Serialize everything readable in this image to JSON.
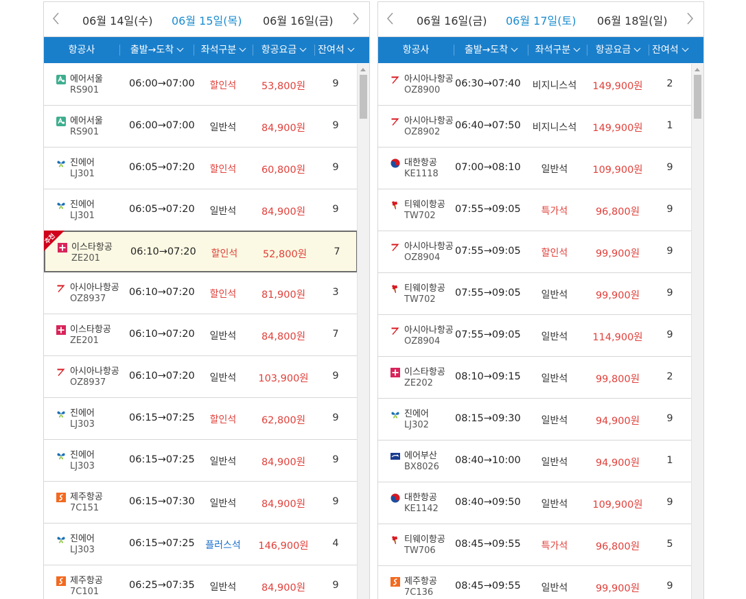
{
  "columns": {
    "airline": "항공사",
    "time": "출발→도착",
    "seat": "좌석구분",
    "fare": "항공요금",
    "remaining": "잔여석"
  },
  "badge_text": "추천",
  "colors": {
    "accent": "#1a7fcb",
    "fare": "#e0403a",
    "active_date": "#1a8ccf",
    "highlight_bg": "#fbf9e3"
  },
  "left": {
    "dates": [
      "06월 14일(수)",
      "06월 15일(목)",
      "06월 16일(금)"
    ],
    "active_index": 1,
    "rows": [
      {
        "logo": "air-seoul",
        "name": "에어서울",
        "flight": "RS901",
        "time": "06:00→07:00",
        "seat": "할인석",
        "seat_style": "red",
        "fare": "53,800원",
        "remain": "9"
      },
      {
        "logo": "air-seoul",
        "name": "에어서울",
        "flight": "RS901",
        "time": "06:00→07:00",
        "seat": "일반석",
        "seat_style": "normal",
        "fare": "84,900원",
        "remain": "9"
      },
      {
        "logo": "jin-air",
        "name": "진에어",
        "flight": "LJ301",
        "time": "06:05→07:20",
        "seat": "할인석",
        "seat_style": "red",
        "fare": "60,800원",
        "remain": "9"
      },
      {
        "logo": "jin-air",
        "name": "진에어",
        "flight": "LJ301",
        "time": "06:05→07:20",
        "seat": "일반석",
        "seat_style": "normal",
        "fare": "84,900원",
        "remain": "9"
      },
      {
        "logo": "eastar",
        "name": "이스타항공",
        "flight": "ZE201",
        "time": "06:10→07:20",
        "seat": "할인석",
        "seat_style": "red",
        "fare": "52,800원",
        "remain": "7",
        "highlight": true
      },
      {
        "logo": "asiana",
        "name": "아시아나항공",
        "flight": "OZ8937",
        "time": "06:10→07:20",
        "seat": "할인석",
        "seat_style": "red",
        "fare": "81,900원",
        "remain": "3"
      },
      {
        "logo": "eastar",
        "name": "이스타항공",
        "flight": "ZE201",
        "time": "06:10→07:20",
        "seat": "일반석",
        "seat_style": "normal",
        "fare": "84,800원",
        "remain": "7"
      },
      {
        "logo": "asiana",
        "name": "아시아나항공",
        "flight": "OZ8937",
        "time": "06:10→07:20",
        "seat": "일반석",
        "seat_style": "normal",
        "fare": "103,900원",
        "remain": "9"
      },
      {
        "logo": "jin-air",
        "name": "진에어",
        "flight": "LJ303",
        "time": "06:15→07:25",
        "seat": "할인석",
        "seat_style": "red",
        "fare": "62,800원",
        "remain": "9"
      },
      {
        "logo": "jin-air",
        "name": "진에어",
        "flight": "LJ303",
        "time": "06:15→07:25",
        "seat": "일반석",
        "seat_style": "normal",
        "fare": "84,900원",
        "remain": "9"
      },
      {
        "logo": "jeju",
        "name": "제주항공",
        "flight": "7C151",
        "time": "06:15→07:30",
        "seat": "일반석",
        "seat_style": "normal",
        "fare": "84,900원",
        "remain": "9"
      },
      {
        "logo": "jin-air",
        "name": "진에어",
        "flight": "LJ303",
        "time": "06:15→07:25",
        "seat": "플러스석",
        "seat_style": "blue",
        "fare": "146,900원",
        "remain": "4"
      },
      {
        "logo": "jeju",
        "name": "제주항공",
        "flight": "7C101",
        "time": "06:25→07:35",
        "seat": "일반석",
        "seat_style": "normal",
        "fare": "84,900원",
        "remain": "9"
      }
    ]
  },
  "right": {
    "dates": [
      "06월 16일(금)",
      "06월 17일(토)",
      "06월 18일(일)"
    ],
    "active_index": 1,
    "rows": [
      {
        "logo": "asiana",
        "name": "아시아나항공",
        "flight": "OZ8900",
        "time": "06:30→07:40",
        "seat": "비지니스석",
        "seat_style": "normal",
        "fare": "149,900원",
        "remain": "2"
      },
      {
        "logo": "asiana",
        "name": "아시아나항공",
        "flight": "OZ8902",
        "time": "06:40→07:50",
        "seat": "비지니스석",
        "seat_style": "normal",
        "fare": "149,900원",
        "remain": "1"
      },
      {
        "logo": "korean-air",
        "name": "대한항공",
        "flight": "KE1118",
        "time": "07:00→08:10",
        "seat": "일반석",
        "seat_style": "normal",
        "fare": "109,900원",
        "remain": "9"
      },
      {
        "logo": "tway",
        "name": "티웨이항공",
        "flight": "TW702",
        "time": "07:55→09:05",
        "seat": "특가석",
        "seat_style": "red",
        "fare": "96,800원",
        "remain": "9"
      },
      {
        "logo": "asiana",
        "name": "아시아나항공",
        "flight": "OZ8904",
        "time": "07:55→09:05",
        "seat": "할인석",
        "seat_style": "red",
        "fare": "99,900원",
        "remain": "9"
      },
      {
        "logo": "tway",
        "name": "티웨이항공",
        "flight": "TW702",
        "time": "07:55→09:05",
        "seat": "일반석",
        "seat_style": "normal",
        "fare": "99,900원",
        "remain": "9"
      },
      {
        "logo": "asiana",
        "name": "아시아나항공",
        "flight": "OZ8904",
        "time": "07:55→09:05",
        "seat": "일반석",
        "seat_style": "normal",
        "fare": "114,900원",
        "remain": "9"
      },
      {
        "logo": "eastar",
        "name": "이스타항공",
        "flight": "ZE202",
        "time": "08:10→09:15",
        "seat": "일반석",
        "seat_style": "normal",
        "fare": "99,800원",
        "remain": "2"
      },
      {
        "logo": "jin-air",
        "name": "진에어",
        "flight": "LJ302",
        "time": "08:15→09:30",
        "seat": "일반석",
        "seat_style": "normal",
        "fare": "94,900원",
        "remain": "9"
      },
      {
        "logo": "air-busan",
        "name": "에어부산",
        "flight": "BX8026",
        "time": "08:40→10:00",
        "seat": "일반석",
        "seat_style": "normal",
        "fare": "94,900원",
        "remain": "1"
      },
      {
        "logo": "korean-air",
        "name": "대한항공",
        "flight": "KE1142",
        "time": "08:40→09:50",
        "seat": "일반석",
        "seat_style": "normal",
        "fare": "109,900원",
        "remain": "9"
      },
      {
        "logo": "tway",
        "name": "티웨이항공",
        "flight": "TW706",
        "time": "08:45→09:55",
        "seat": "특가석",
        "seat_style": "red",
        "fare": "96,800원",
        "remain": "5"
      },
      {
        "logo": "jeju",
        "name": "제주항공",
        "flight": "7C136",
        "time": "08:45→09:55",
        "seat": "일반석",
        "seat_style": "normal",
        "fare": "99,900원",
        "remain": "9"
      }
    ]
  }
}
